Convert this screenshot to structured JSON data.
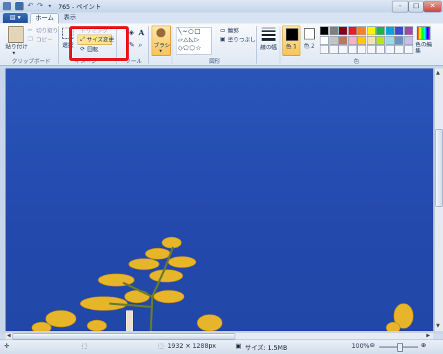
{
  "titlebar": {
    "title": "765 - ペイント",
    "minimize": "–",
    "maximize": "□",
    "close": "✕"
  },
  "tabs": [
    {
      "label": "ホーム"
    },
    {
      "label": "表示"
    }
  ],
  "clipboard": {
    "paste": "貼り付け",
    "cut": "切り取り",
    "copy": "コピー",
    "group": "クリップボード"
  },
  "image": {
    "select": "選択",
    "crop": "トリミング",
    "resize": "サイズ変更",
    "rotate": "回転",
    "group": "イメージ"
  },
  "tools": {
    "group": "ツール",
    "text_tool": "A"
  },
  "brush": {
    "label": "ブラシ"
  },
  "shapes": {
    "outline": "輪郭",
    "fill": "塗りつぶし",
    "group": "図形"
  },
  "size": {
    "label": "線の幅"
  },
  "colors": {
    "color1": "色 1",
    "color2": "色 2",
    "edit": "色の編集",
    "group": "色",
    "color1_value": "#000000",
    "color2_value": "#ffffff",
    "row1": [
      "#000000",
      "#7f7f7f",
      "#880015",
      "#ed1c24",
      "#ff7f27",
      "#fff200",
      "#22b14c",
      "#00a2e8",
      "#3f48cc",
      "#a349a4"
    ],
    "row2": [
      "#ffffff",
      "#c3c3c3",
      "#b97a57",
      "#ffaec9",
      "#ffc90e",
      "#efe4b0",
      "#b5e61d",
      "#99d9ea",
      "#7092be",
      "#c8bfe7"
    ]
  },
  "status": {
    "dimensions": "1932 × 1288px",
    "filesize": "サイズ: 1.5MB",
    "zoom": "100%"
  }
}
